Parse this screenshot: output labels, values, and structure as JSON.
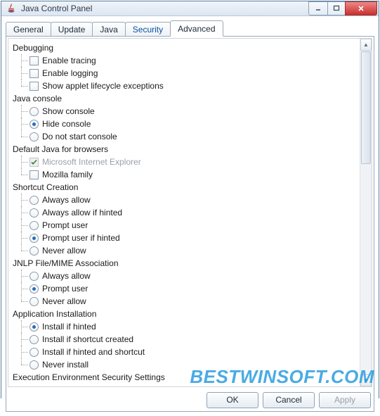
{
  "window": {
    "title": "Java Control Panel"
  },
  "tabs": {
    "general": "General",
    "update": "Update",
    "java": "Java",
    "security": "Security",
    "advanced": "Advanced"
  },
  "groups": {
    "debugging": {
      "label": "Debugging",
      "items": [
        {
          "label": "Enable tracing",
          "type": "check",
          "checked": false
        },
        {
          "label": "Enable logging",
          "type": "check",
          "checked": false
        },
        {
          "label": "Show applet lifecycle exceptions",
          "type": "check",
          "checked": false
        }
      ]
    },
    "java_console": {
      "label": "Java console",
      "items": [
        {
          "label": "Show console",
          "type": "radio",
          "checked": false
        },
        {
          "label": "Hide console",
          "type": "radio",
          "checked": true
        },
        {
          "label": "Do not start console",
          "type": "radio",
          "checked": false
        }
      ]
    },
    "default_java": {
      "label": "Default Java for browsers",
      "items": [
        {
          "label": "Microsoft Internet Explorer",
          "type": "check",
          "checked": true,
          "disabled": true
        },
        {
          "label": "Mozilla family",
          "type": "check",
          "checked": false
        }
      ]
    },
    "shortcut": {
      "label": "Shortcut Creation",
      "items": [
        {
          "label": "Always allow",
          "type": "radio",
          "checked": false
        },
        {
          "label": "Always allow if hinted",
          "type": "radio",
          "checked": false
        },
        {
          "label": "Prompt user",
          "type": "radio",
          "checked": false
        },
        {
          "label": "Prompt user if hinted",
          "type": "radio",
          "checked": true
        },
        {
          "label": "Never allow",
          "type": "radio",
          "checked": false
        }
      ]
    },
    "jnlp": {
      "label": "JNLP File/MIME Association",
      "items": [
        {
          "label": "Always allow",
          "type": "radio",
          "checked": false
        },
        {
          "label": "Prompt user",
          "type": "radio",
          "checked": true
        },
        {
          "label": "Never allow",
          "type": "radio",
          "checked": false
        }
      ]
    },
    "app_install": {
      "label": "Application Installation",
      "items": [
        {
          "label": "Install if hinted",
          "type": "radio",
          "checked": true
        },
        {
          "label": "Install if shortcut created",
          "type": "radio",
          "checked": false
        },
        {
          "label": "Install if hinted and shortcut",
          "type": "radio",
          "checked": false
        },
        {
          "label": "Never install",
          "type": "radio",
          "checked": false
        }
      ]
    },
    "exec_env": {
      "label": "Execution Environment Security Settings"
    }
  },
  "buttons": {
    "ok": "OK",
    "cancel": "Cancel",
    "apply": "Apply"
  },
  "watermark": "BESTWINSOFT.COM"
}
